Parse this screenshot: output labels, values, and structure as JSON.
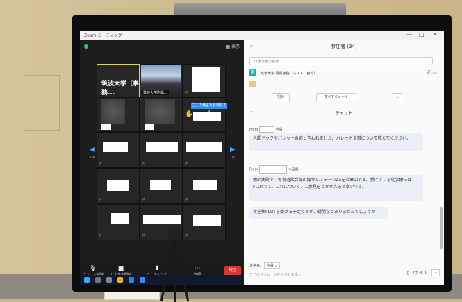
{
  "window": {
    "title": "Zoom ミーティング",
    "view_label": "表示"
  },
  "gallery": {
    "active_tile_name": "筑波大学（事務...",
    "photo_tile_label": "筑波大学附属...",
    "raise_hand_label": "ここで発言をお待ちです",
    "page_left": "1/4",
    "page_right": "1/1"
  },
  "toolbar": {
    "items": [
      {
        "icon": "microphone-icon",
        "label": "ミュート解除"
      },
      {
        "icon": "video-icon",
        "label": "ビデオの開始"
      },
      {
        "icon": "share-icon",
        "label": "ミーティング"
      },
      {
        "icon": "more-icon",
        "label": "詳細"
      }
    ],
    "end_label": "終了"
  },
  "participants": {
    "title": "参加者 (34)",
    "search_placeholder": "Q 参加者の検索",
    "first_participant": "筑波大学 附属病院（ホスト、自分）",
    "avatar_letter": "筑",
    "invite_label": "招待",
    "mute_all_label": "すべてミュート",
    "more_label": "..."
  },
  "chat": {
    "title": "チャット",
    "messages": [
      {
        "sender_suffix": "全員",
        "text": "人間ドックやパレット食道と言われました。バレット食道について教えてください。"
      },
      {
        "sender_suffix": "へ全員",
        "text": "他の病院で、胃食道接合部の腺がんステージ4aを治療中です。受けている化学療法はFLOTです。これについて、ご意見をうかがえると幸いです。"
      },
      {
        "sender_suffix": "",
        "text": "胃全摘FLOTを受ける予定ですが、疑問などありませんでしょうか"
      }
    ],
    "to_label": "送信先:",
    "to_value": "全員",
    "input_placeholder": "ここにメッセージを入力します...",
    "file_label": "ファイル",
    "more_label": "..."
  },
  "colors": {
    "accent_blue": "#2d8cff",
    "end_red": "#e0332e",
    "active_border": "#e7d63a"
  }
}
